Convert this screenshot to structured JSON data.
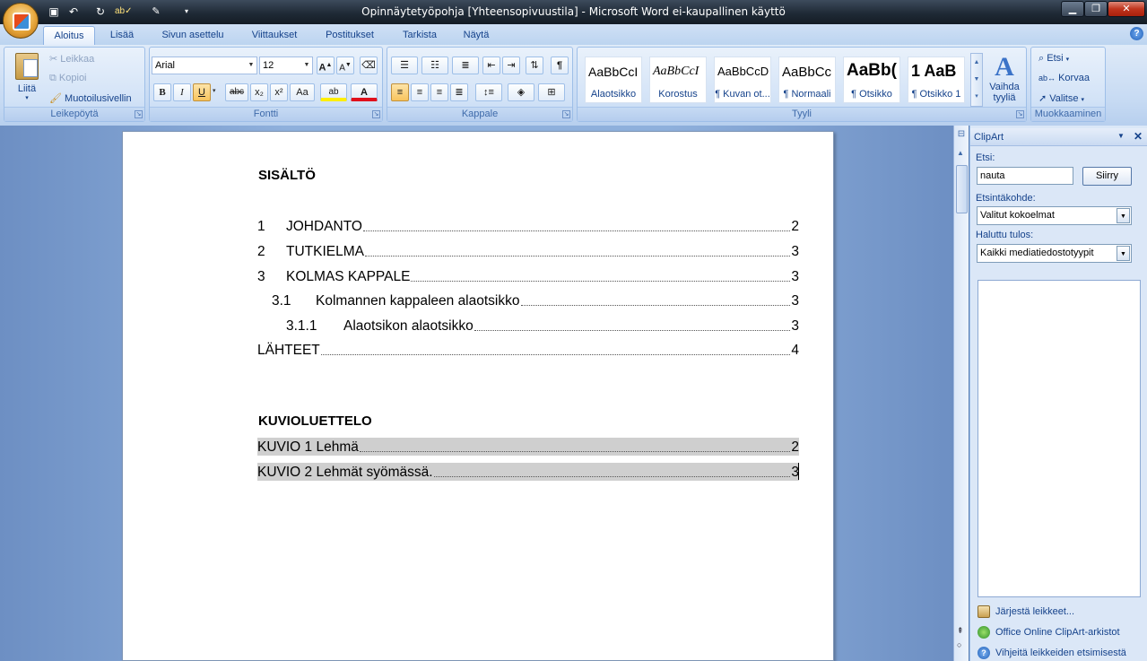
{
  "window": {
    "title": "Opinnäytetyöpohja [Yhteensopivuustila] - Microsoft Word ei-kaupallinen käyttö",
    "minimize": "▁",
    "maximize": "❐",
    "close": "✕"
  },
  "quick_access": {
    "save_icon": "save-icon",
    "undo_icon": "undo-icon",
    "redo_icon": "redo-icon",
    "spelling_icon": "spelling-icon",
    "customize_icon": "chevron-down-icon"
  },
  "tabs": [
    "Aloitus",
    "Lisää",
    "Sivun asettelu",
    "Viittaukset",
    "Postitukset",
    "Tarkista",
    "Näytä"
  ],
  "help": "?",
  "ribbon": {
    "clipboard": {
      "label": "Leikepöytä",
      "paste": "Liitä",
      "cut": "Leikkaa",
      "copy": "Kopioi",
      "format_painter": "Muotoilusivellin"
    },
    "font": {
      "label": "Fontti",
      "font_name": "Arial",
      "font_size": "12",
      "grow": "A",
      "shrink": "A",
      "bold": "B",
      "italic": "I",
      "underline": "U",
      "strike": "abc",
      "subscript": "x₂",
      "superscript": "x²",
      "change_case": "Aa",
      "highlight": "ab",
      "font_color": "A"
    },
    "paragraph": {
      "label": "Kappale",
      "pilcrow": "¶"
    },
    "styles": {
      "label": "Tyyli",
      "items": [
        {
          "sample": "AaBbCcI",
          "name": "Alaotsikko"
        },
        {
          "sample": "AaBbCcI",
          "name": "Korostus"
        },
        {
          "sample": "AaBbCcD",
          "name": "¶ Kuvan ot..."
        },
        {
          "sample": "AaBbCc",
          "name": "¶ Normaali"
        },
        {
          "sample": "AaBb(",
          "name": "¶ Otsikko"
        },
        {
          "sample": "1 AaB",
          "name": "¶ Otsikko 1"
        }
      ],
      "change_styles": "Vaihda tyyliä"
    },
    "editing": {
      "label": "Muokkaaminen",
      "find": "Etsi",
      "replace": "Korvaa",
      "select": "Valitse"
    }
  },
  "document": {
    "toc_heading": "SISÄLTÖ",
    "toc": [
      {
        "num": "1",
        "text": "JOHDANTO",
        "page": "2"
      },
      {
        "num": "2",
        "text": "TUTKIELMA",
        "page": "3"
      },
      {
        "num": "3",
        "text": "KOLMAS KAPPALE",
        "page": "3"
      },
      {
        "num": "3.1",
        "text": "Kolmannen kappaleen alaotsikko",
        "page": "3"
      },
      {
        "num": "3.1.1",
        "text": "Alaotsikon alaotsikko",
        "page": "3"
      },
      {
        "num": "",
        "text": "LÄHTEET",
        "page": "4"
      }
    ],
    "figures_heading": "KUVIOLUETTELO",
    "figures": [
      {
        "text": "KUVIO 1 Lehmä",
        "page": "2"
      },
      {
        "text": "KUVIO 2 Lehmät syömässä.",
        "page": "3"
      }
    ]
  },
  "clipart": {
    "title": "ClipArt",
    "search_label": "Etsi:",
    "search_value": "nauta",
    "go_button": "Siirry",
    "search_in_label": "Etsintäkohde:",
    "search_in_value": "Valitut kokoelmat",
    "results_label": "Haluttu tulos:",
    "results_value": "Kaikki mediatiedostotyypit",
    "links": [
      "Järjestä leikkeet...",
      "Office Online ClipArt-arkistot",
      "Vihjeitä leikkeiden etsimisestä"
    ]
  }
}
